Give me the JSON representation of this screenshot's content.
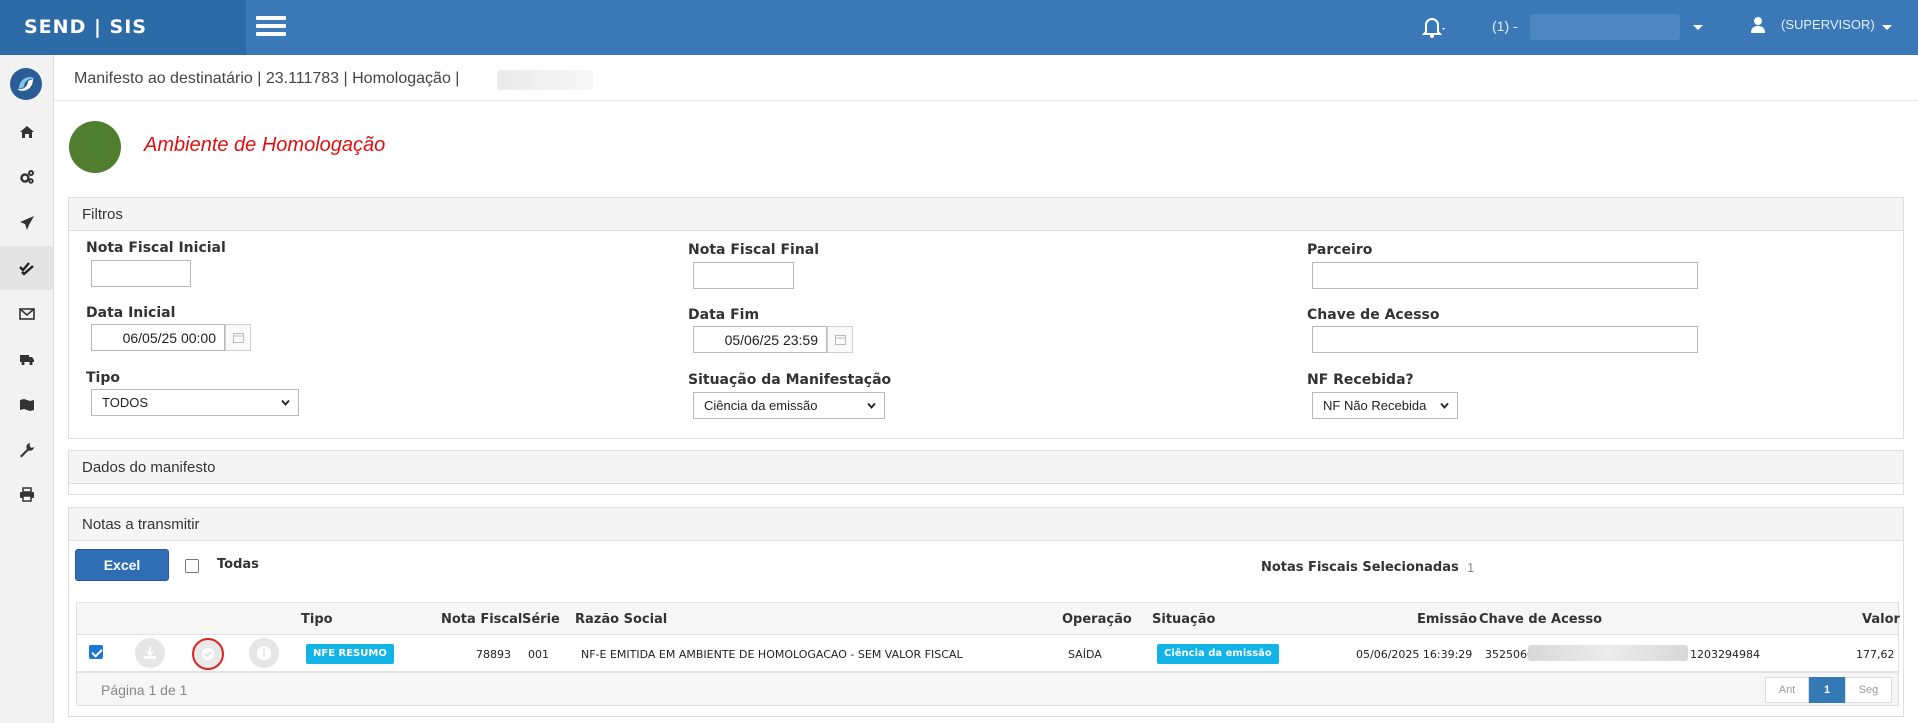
{
  "header": {
    "brand": "SEND | SIS",
    "company_label": "(1) -",
    "user_label": "(SUPERVISOR)"
  },
  "sidebar": {
    "items": [
      {
        "icon": "home-icon"
      },
      {
        "icon": "gears-icon"
      },
      {
        "icon": "paper-plane-icon"
      },
      {
        "icon": "double-check-icon",
        "active": true
      },
      {
        "icon": "envelope-icon"
      },
      {
        "icon": "truck-icon"
      },
      {
        "icon": "map-icon"
      },
      {
        "icon": "wrench-icon"
      },
      {
        "icon": "print-icon"
      }
    ]
  },
  "breadcrumb": "Manifesto ao destinatário | 23.111783 | Homologação |",
  "environment": {
    "title": "Ambiente de Homologação",
    "color": "#4f7f2e"
  },
  "filters": {
    "title": "Filtros",
    "nf_inicial": {
      "label": "Nota Fiscal Inicial",
      "value": ""
    },
    "nf_final": {
      "label": "Nota Fiscal Final",
      "value": ""
    },
    "parceiro": {
      "label": "Parceiro",
      "value": ""
    },
    "data_inicial": {
      "label": "Data Inicial",
      "value": "06/05/25 00:00"
    },
    "data_fim": {
      "label": "Data Fim",
      "value": "05/06/25 23:59"
    },
    "chave": {
      "label": "Chave de Acesso",
      "value": ""
    },
    "tipo": {
      "label": "Tipo",
      "value": "TODOS"
    },
    "situacao": {
      "label": "Situação da Manifestação",
      "value": "Ciência da emissão"
    },
    "nf_recebida": {
      "label": "NF Recebida?",
      "value": "NF Não Recebida"
    }
  },
  "dados_manifesto": {
    "title": "Dados do manifesto"
  },
  "notas": {
    "title": "Notas a transmitir",
    "excel_label": "Excel",
    "todas_label": "Todas",
    "selecionadas_label": "Notas Fiscais Selecionadas",
    "selecionadas_count": "1",
    "columns": [
      "Tipo",
      "Nota Fiscal",
      "Série",
      "Razão Social",
      "Operação",
      "Situação",
      "Emissão",
      "Chave de Acesso",
      "Valor"
    ],
    "rows": [
      {
        "checked": true,
        "tipo": "NFE RESUMO",
        "nota_fiscal": "78893",
        "serie": "001",
        "razao_social": "NF-E EMITIDA EM AMBIENTE DE HOMOLOGACAO - SEM VALOR FISCAL",
        "operacao": "SAÍDA",
        "situacao": "Ciência da emissão",
        "emissao": "05/06/2025 16:39:29",
        "chave_prefix": "3525060",
        "chave_suffix": "1203294984",
        "valor": "177,62"
      }
    ],
    "page_info": "Página 1 de 1",
    "pager": {
      "prev": "Ant",
      "current": "1",
      "next": "Seg"
    }
  },
  "colors": {
    "topbar": "#3a78b7",
    "badge": "#12b3e6",
    "env_title": "#e01010"
  }
}
